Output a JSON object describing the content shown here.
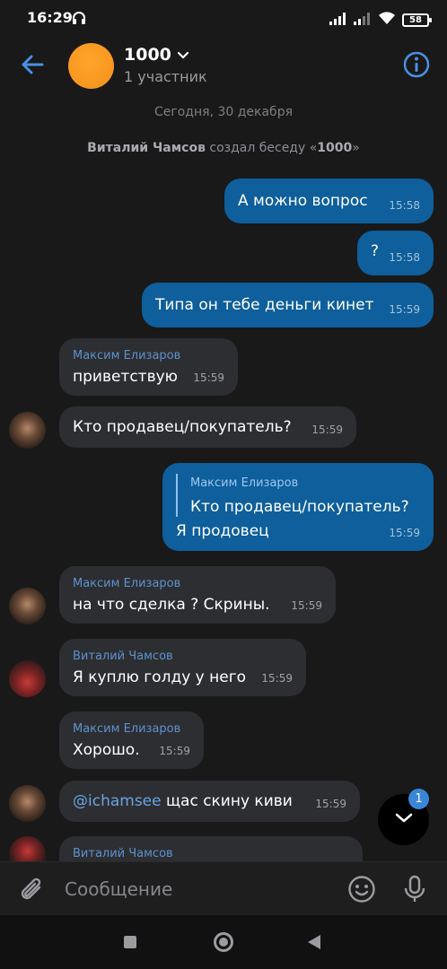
{
  "status_bar": {
    "time": "16:29",
    "battery": "58"
  },
  "header": {
    "title": "1000",
    "subtitle": "1 участник"
  },
  "date_separator": "Сегодня, 30 декабря",
  "system_message": {
    "actor": "Виталий Чамсов",
    "text": " создал беседу «",
    "chat": "1000",
    "end": "»"
  },
  "messages": [
    {
      "text": "А можно вопрос",
      "time": "15:58"
    },
    {
      "text": "?",
      "time": "15:58"
    },
    {
      "text": "Типа он тебе деньги кинет",
      "time": "15:59"
    },
    {
      "sender": "Максим Елизаров",
      "text": "приветствую",
      "time": "15:59"
    },
    {
      "text": "Кто продавец/покупатель?",
      "time": "15:59"
    },
    {
      "quote_name": "Максим Елизаров",
      "quote_text": "Кто продавец/покупатель?",
      "text": "Я продовец",
      "time": "15:59"
    },
    {
      "sender": "Максим Елизаров",
      "text": "на что сделка ? Скрины.",
      "time": "15:59"
    },
    {
      "sender": "Виталий Чамсов",
      "text": "Я куплю голду у него",
      "time": "15:59"
    },
    {
      "sender": "Максим Елизаров",
      "text": "Хорошо.",
      "time": "15:59"
    },
    {
      "mention": "@ichamsee",
      "text": " щас скину киви",
      "time": "15:59"
    },
    {
      "sender": "Виталий Чамсов"
    }
  ],
  "scroll_fab": {
    "badge": "1"
  },
  "input": {
    "placeholder": "Сообщение"
  },
  "colors": {
    "accent": "#3a86d6",
    "outgoing_bubble": "#0e5f9b",
    "incoming_bubble": "#2d2e31",
    "background": "#19191a"
  },
  "icons": [
    "headset-icon",
    "signal-icon",
    "wifi-icon",
    "battery-icon",
    "back-arrow-icon",
    "chevron-down-icon",
    "info-icon",
    "paperclip-icon",
    "emoji-icon",
    "mic-icon"
  ]
}
